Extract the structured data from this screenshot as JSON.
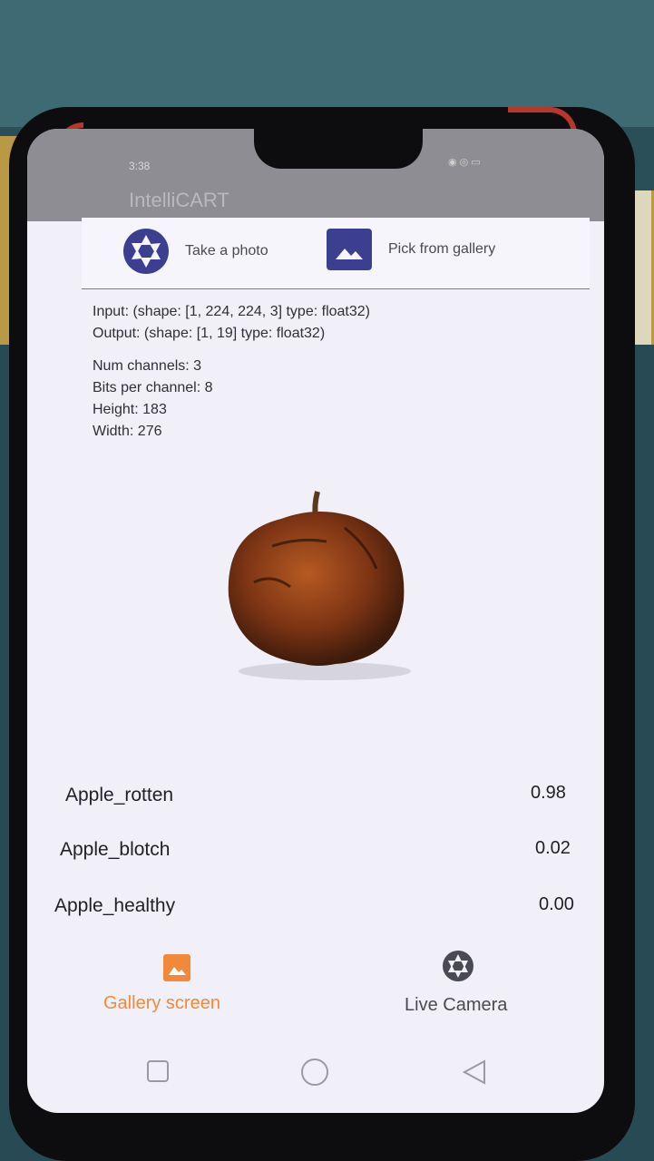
{
  "status_bar": {
    "time": "3:38"
  },
  "app": {
    "title": "IntelliCART"
  },
  "toolbar": {
    "take_photo_label": "Take a photo",
    "pick_gallery_label": "Pick from gallery"
  },
  "model_info": {
    "input": "Input: (shape: [1, 224, 224, 3] type: float32)",
    "output": "Output: (shape: [1, 19] type: float32)",
    "num_channels": "Num channels: 3",
    "bits_per_channel": "Bits per channel: 8",
    "height": "Height: 183",
    "width": "Width: 276"
  },
  "results": [
    {
      "label": "Apple_rotten",
      "score": "0.98"
    },
    {
      "label": "Apple_blotch",
      "score": "0.02"
    },
    {
      "label": "Apple_healthy",
      "score": "0.00"
    }
  ],
  "bottom_nav": {
    "gallery_label": "Gallery screen",
    "camera_label": "Live Camera",
    "active_color": "#f08a3a",
    "inactive_color": "#4a4a52"
  },
  "colors": {
    "accent_icon": "#3c3f8f"
  }
}
